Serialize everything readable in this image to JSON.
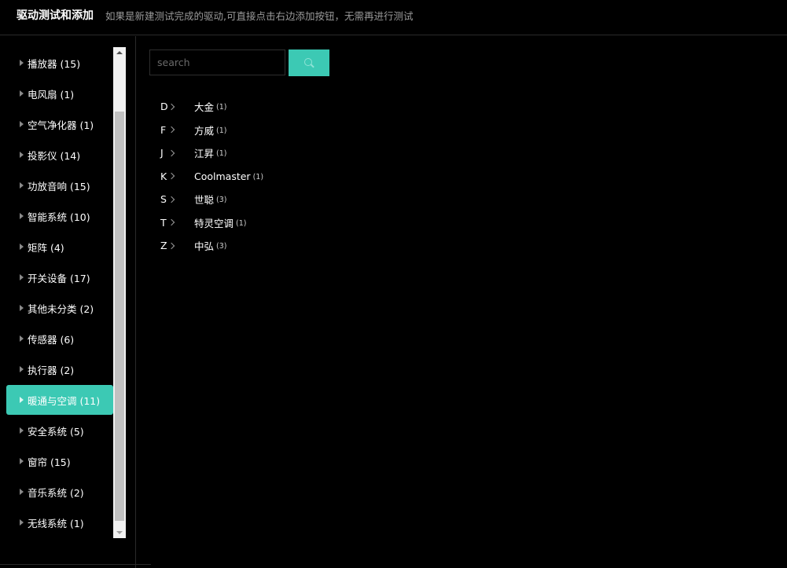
{
  "header": {
    "title": "驱动测试和添加",
    "subtitle": "如果是新建测试完成的驱动,可直接点击右边添加按钮，无需再进行测试"
  },
  "sidebar": {
    "active_index": 11,
    "items": [
      {
        "label": "播放器 (15)"
      },
      {
        "label": "电风扇 (1)"
      },
      {
        "label": "空气净化器 (1)"
      },
      {
        "label": "投影仪 (14)"
      },
      {
        "label": "功放音响 (15)"
      },
      {
        "label": "智能系统 (10)"
      },
      {
        "label": "矩阵 (4)"
      },
      {
        "label": "开关设备 (17)"
      },
      {
        "label": "其他未分类 (2)"
      },
      {
        "label": "传感器 (6)"
      },
      {
        "label": "执行器 (2)"
      },
      {
        "label": "暖通与空调 (11)"
      },
      {
        "label": "安全系统 (5)"
      },
      {
        "label": "窗帘 (15)"
      },
      {
        "label": "音乐系统 (2)"
      },
      {
        "label": "无线系统 (1)"
      }
    ]
  },
  "search": {
    "placeholder": "search",
    "value": "",
    "button_icon": "search-icon"
  },
  "brands": [
    {
      "letter": "D",
      "name": "大金",
      "count": "(1)"
    },
    {
      "letter": "F",
      "name": "方威",
      "count": "(1)"
    },
    {
      "letter": "J",
      "name": "江昇",
      "count": "(1)"
    },
    {
      "letter": "K",
      "name": "Coolmaster",
      "count": "(1)"
    },
    {
      "letter": "S",
      "name": "世聪",
      "count": "(3)"
    },
    {
      "letter": "T",
      "name": "特灵空调",
      "count": "(1)"
    },
    {
      "letter": "Z",
      "name": "中弘",
      "count": "(3)"
    }
  ],
  "colors": {
    "accent": "#3cc9b4",
    "background": "#000000",
    "subtitle": "#9a9a9a"
  }
}
